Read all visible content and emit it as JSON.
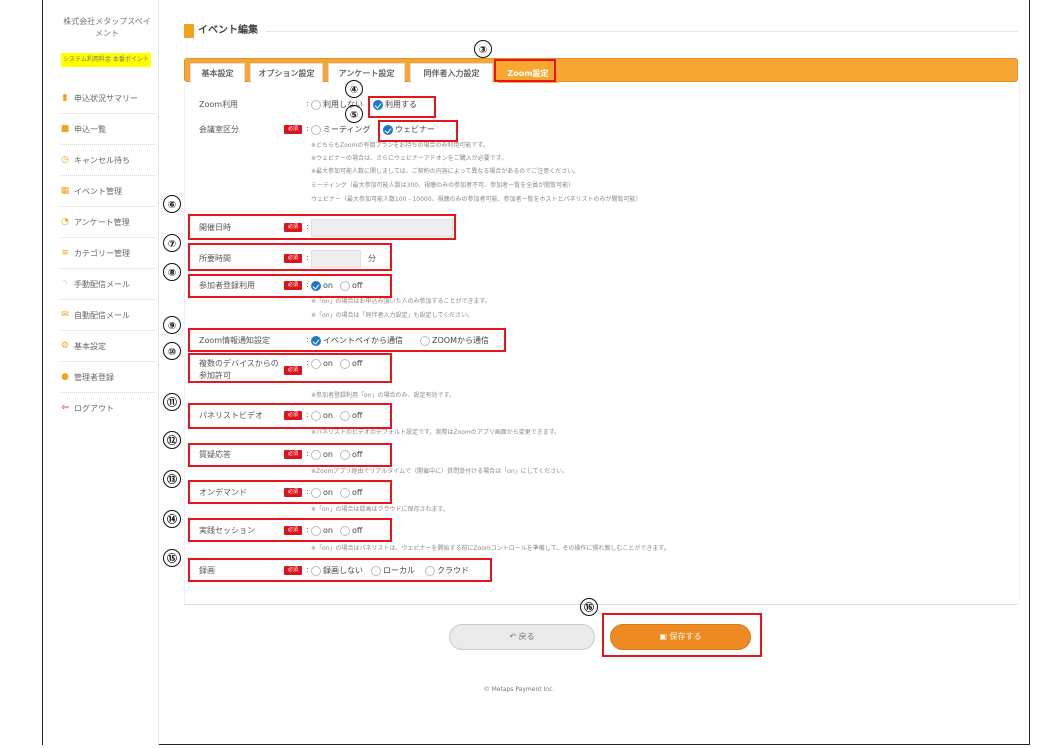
{
  "sidebar": {
    "org_name": "株式会社メタップスペイメント",
    "highlight_text": "システム利用料金 本番ポイント",
    "items": [
      {
        "label": "申込状況サマリー",
        "icon": "bar-chart-icon",
        "color": "#f2a21c"
      },
      {
        "label": "申込一覧",
        "icon": "book-icon",
        "color": "#f2a21c"
      },
      {
        "label": "キャンセル待ち",
        "icon": "clock-icon",
        "color": "#f2a21c"
      },
      {
        "label": "イベント管理",
        "icon": "grid-icon",
        "color": "#f2a21c"
      },
      {
        "label": "アンケート管理",
        "icon": "pie-chart-icon",
        "color": "#f2a21c"
      },
      {
        "label": "カテゴリー管理",
        "icon": "list-icon",
        "color": "#f2a21c"
      },
      {
        "label": "手動配信メール",
        "icon": "rss-icon",
        "color": "#f2a21c"
      },
      {
        "label": "自動配信メール",
        "icon": "mail-icon",
        "color": "#f2a21c"
      },
      {
        "label": "基本設定",
        "icon": "gear-icon",
        "color": "#f2a21c"
      },
      {
        "label": "管理者登録",
        "icon": "users-icon",
        "color": "#f2a21c"
      },
      {
        "label": "ログアウト",
        "icon": "logout-icon",
        "color": "#d9161d"
      }
    ]
  },
  "page": {
    "title": "イベント編集",
    "tabs": [
      "基本設定",
      "オプション設定",
      "アンケート設定",
      "同伴者入力設定",
      "Zoom設定"
    ],
    "active_tab": "Zoom設定"
  },
  "form": {
    "req_badge": "必須",
    "colon": ":",
    "zoom_use": {
      "label": "Zoom利用",
      "options": [
        "利用しない",
        "利用する"
      ],
      "selected": "利用する"
    },
    "room_type": {
      "label": "会議室区分",
      "options": [
        "ミーティング",
        "ウェビナー"
      ],
      "selected": "ウェビナー",
      "notes": [
        "※どちらもZoomの有償プランをお持ちの場合のみ利用可能です。",
        "※ウェビナーの場合は、さらにウェビナーアドオンをご購入が必要です。",
        "※最大参加可能人数に関しましては、ご契約の内容によって異なる場合があるのでご注意ください。",
        "ミーティング（最大参加可能人数は300、視聴のみの参加者不可、参加者一覧を全員が閲覧可能）",
        "ウェビナー（最大参加可能人数100 - 10000、視聴のみの参加者可能、参加者一覧をホストとパネリストのみが閲覧可能）"
      ]
    },
    "start_datetime": {
      "label": "開催日時"
    },
    "duration": {
      "label": "所要時間",
      "unit": "分"
    },
    "registrant": {
      "label": "参加者登録利用",
      "options": [
        "on",
        "off"
      ],
      "selected": "on",
      "notes": [
        "※「on」の場合はお申込み頂いた人のみ参加することができます。",
        "※「on」の場合は「同伴者入力設定」も設定してください。"
      ]
    },
    "notify": {
      "label": "Zoom情報通知設定",
      "options": [
        "イベントペイから通信",
        "ZOOMから通信"
      ],
      "selected": "イベントペイから通信"
    },
    "multi_device": {
      "label": "複数のデバイスからの参加許可",
      "options": [
        "on",
        "off"
      ],
      "selected": "",
      "notes": [
        "※参加者登録利用「on」の場合のみ、設定有効です。"
      ]
    },
    "panelist_video": {
      "label": "パネリストビデオ",
      "options": [
        "on",
        "off"
      ],
      "selected": "",
      "notes": [
        "※パネリストのビデオのデフォルト設定です。実際はZoomのアプリ画面から変更できます。"
      ]
    },
    "qa": {
      "label": "質疑応答",
      "options": [
        "on",
        "off"
      ],
      "selected": "",
      "notes": [
        "※Zoomアプリ経由でリアルタイムで（開催中に）質問受付ける場合は「on」にしてください。"
      ]
    },
    "ondemand": {
      "label": "オンデマンド",
      "options": [
        "on",
        "off"
      ],
      "selected": "",
      "notes": [
        "※「on」の場合は録画はクラウドに保存されます。"
      ]
    },
    "practice": {
      "label": "実践セッション",
      "options": [
        "on",
        "off"
      ],
      "selected": "",
      "notes": [
        "※「on」の場合はパネリストは、ウェビナーを開始する前にZoomコントロールを準備して、その操作に慣れ親しむことができます。"
      ]
    },
    "recording": {
      "label": "録画",
      "options": [
        "録画しない",
        "ローカル",
        "クラウド"
      ],
      "selected": ""
    }
  },
  "annotations": [
    "③",
    "④",
    "⑤",
    "⑥",
    "⑦",
    "⑧",
    "⑨",
    "⑩",
    "⑪",
    "⑫",
    "⑬",
    "⑭",
    "⑮",
    "⑯"
  ],
  "buttons": {
    "back": "戻る",
    "save": "保存する"
  },
  "footer": "© Metaps Payment Inc."
}
